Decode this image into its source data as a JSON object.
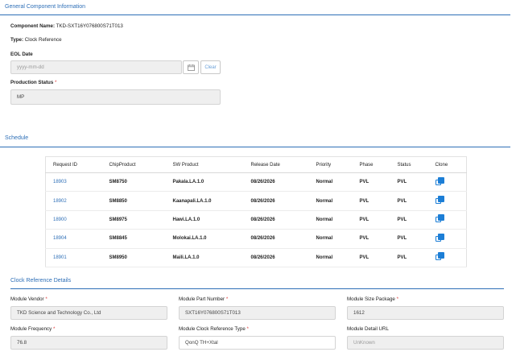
{
  "general": {
    "title": "General Component Information",
    "component_name_label": "Component Name:",
    "component_name_value": "TKD-SXT16Y076800S71T013",
    "type_label": "Type:",
    "type_value": "Clock Reference",
    "eol_label": "EOL Date",
    "eol_placeholder": "yyyy-mm-dd",
    "clear_label": "Clear",
    "production_status_label": "Production Status",
    "required_mark": "*",
    "production_status_value": "MP"
  },
  "schedule": {
    "title": "Schedule",
    "columns": [
      "Request ID",
      "ChipProduct",
      "SW Product",
      "Release Date",
      "Priority",
      "Phase",
      "Status",
      "Clone"
    ],
    "rows": [
      {
        "request_id": "18903",
        "chip": "SM8750",
        "sw": "Pakala.LA.1.0",
        "release": "08/26/2026",
        "priority": "Normal",
        "phase": "PVL",
        "status": "PVL"
      },
      {
        "request_id": "18902",
        "chip": "SM8850",
        "sw": "Kaanapali.LA.1.0",
        "release": "08/26/2026",
        "priority": "Normal",
        "phase": "PVL",
        "status": "PVL"
      },
      {
        "request_id": "18900",
        "chip": "SM8975",
        "sw": "Hawi.LA.1.0",
        "release": "08/26/2026",
        "priority": "Normal",
        "phase": "PVL",
        "status": "PVL"
      },
      {
        "request_id": "18904",
        "chip": "SM8845",
        "sw": "Molokai.LA.1.0",
        "release": "08/26/2026",
        "priority": "Normal",
        "phase": "PVL",
        "status": "PVL"
      },
      {
        "request_id": "18901",
        "chip": "SM8950",
        "sw": "Maili.LA.1.0",
        "release": "08/26/2026",
        "priority": "Normal",
        "phase": "PVL",
        "status": "PVL"
      }
    ]
  },
  "clock": {
    "title": "Clock Reference Details",
    "module_vendor_label": "Module Vendor",
    "module_vendor_value": "TKD Science and Technology Co., Ltd",
    "module_part_label": "Module Part Number",
    "module_part_value": "SXT16Y076800S71T013",
    "module_size_label": "Module Size Package",
    "module_size_value": "1612",
    "module_freq_label": "Module Frequency",
    "module_freq_value": "76.8",
    "module_clock_type_label": "Module Clock Reference Type",
    "module_clock_type_value": "QonQ TH+Xtal",
    "module_url_label": "Module Detail URL",
    "module_url_value": "UnKnown"
  },
  "colors": {
    "accent": "#2e6fb7",
    "clone_icon": "#1c7ed6",
    "required": "#e04040"
  },
  "icons": {
    "calendar": "calendar-icon",
    "clone": "clone-icon"
  }
}
